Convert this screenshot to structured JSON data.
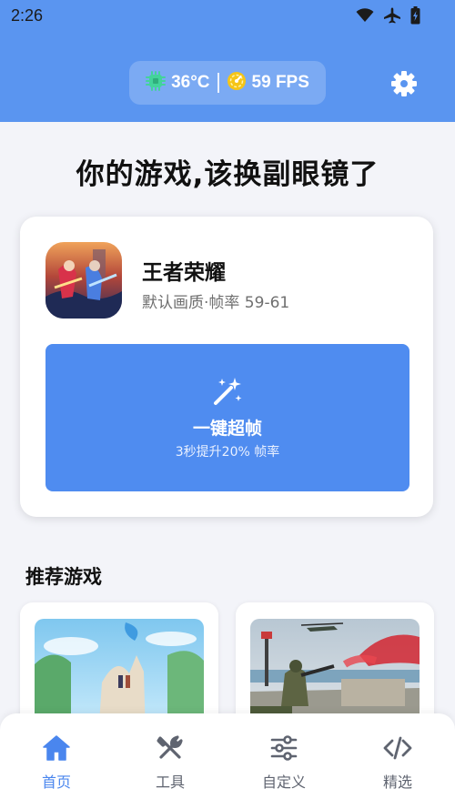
{
  "status_bar": {
    "time": "2:26",
    "icons": [
      "wifi-icon",
      "airplane-icon",
      "battery-icon"
    ]
  },
  "header": {
    "temperature": "36°C",
    "fps": "59 FPS",
    "icons": [
      "chip-icon",
      "speedometer-icon",
      "gear-icon"
    ],
    "bg_color": "#5a95f0"
  },
  "headline": "你的游戏,该换副眼镜了",
  "game_card": {
    "title": "王者荣耀",
    "subtitle": "默认画质·帧率 59-61",
    "boost_button": {
      "label": "一键超帧",
      "sub": "3秒提升20% 帧率",
      "icon": "magic-wand-icon",
      "color": "#4f8cf0"
    }
  },
  "recommended": {
    "title": "推荐游戏",
    "cards": [
      {
        "name": "rec-game-1",
        "thumb": "fantasy-landscape-thumbnail"
      },
      {
        "name": "rec-game-2",
        "thumb": "military-shooter-thumbnail"
      }
    ]
  },
  "bottom_nav": {
    "active_color": "#4a86ee",
    "items": [
      {
        "label": "首页",
        "icon": "home-icon",
        "active": true
      },
      {
        "label": "工具",
        "icon": "tools-icon",
        "active": false
      },
      {
        "label": "自定义",
        "icon": "sliders-icon",
        "active": false
      },
      {
        "label": "精选",
        "icon": "code-icon",
        "active": false
      }
    ]
  }
}
